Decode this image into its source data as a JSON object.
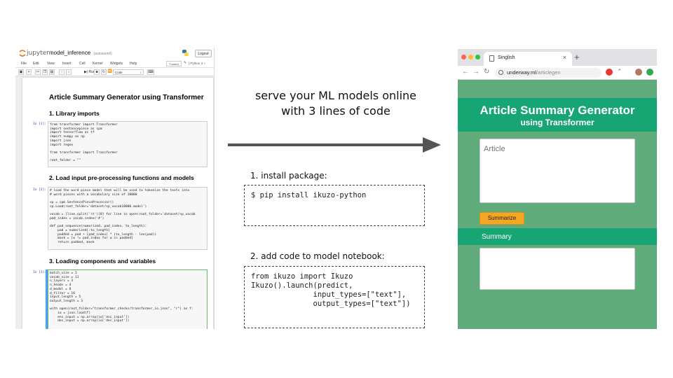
{
  "jupyter": {
    "brand": "jupyter",
    "notebook_name": "model_inference",
    "save_status": "(autosaved)",
    "logout": "Logout",
    "menu": [
      "File",
      "Edit",
      "View",
      "Insert",
      "Cell",
      "Kernel",
      "Widgets",
      "Help"
    ],
    "trusted": "Trusted",
    "kernel": "Python 3",
    "toolbar": {
      "run": "Run",
      "cell_type": "Code"
    },
    "title": "Article Summary Generator using Transformer",
    "sections": [
      {
        "heading": "1. Library imports",
        "prompt": "In [1]:",
        "code": "from transformer import Transformer\nimport sentencepiece as spm\nimport tensorflow as tf\nimport numpy as np\nimport json\nimport regex\n\nfrom transformer import Transformer\n\nroot_folder = \"\""
      },
      {
        "heading": "2. Load input pre-processing functions and models",
        "prompt": "In [2]:",
        "code": "# load the word piece model that will be used to tokenize the texts into\n# word pieces with a vocabulary size of 10000\n\nsp = spm.SentencePieceProcessor()\nsp.Load(root_folder='dataset/sp_vocab10000.model')\n\nvocab = [line.split('\\t')[0] for line in open(root_folder='dataset/sp_vocab\npad_index = vocab.index('#')\n\ndef pad_sequence(numerized, pad_index, to_length):\n    pad = numerized[:to_length]\n    padded = pad + [pad_index] * (to_length - len(pad))\n    mask = [w != pad_index for w in padded]\n    return padded, mask"
      },
      {
        "heading": "3. Loading components and variables",
        "prompt": "In [3]:",
        "code": "batch_size = 1\nvocab_size = 11\nn_layers = 3\nn_heads = 4\nd_model = 8\nd_filter = 16\ninput_length = 5\noutput_length = 3\n\nwith open(root_folder=\"transformer_checks/transformer_io.json\", \"r\") as f:\n    io = json.load(f)\n    enc_input = np.array(io['enc_input'])\n    dec_input = np.array(io['dec_input'])"
      }
    ]
  },
  "middle": {
    "tagline_line1": "serve your ML models online",
    "tagline_line2": "with 3 lines of code",
    "step1_label": "1. install package:",
    "step1_code": "$ pip install ikuzo-python",
    "step2_label": "2. add code to model notebook:",
    "step2_code": "from ikuzo import Ikuzo\nIkuzo().launch(predict,\n              input_types=[\"text\"],\n              output_types=[\"text\"])"
  },
  "browser": {
    "tab_title": "Singlish",
    "url_domain": "underway.ml",
    "url_path": "/articlegen",
    "app_title": "Article Summary Generator",
    "app_subtitle": "using Transformer",
    "article_placeholder": "Article",
    "summarize_button": "Summarize",
    "summary_label": "Summary"
  },
  "colors": {
    "banner_green": "#17a673",
    "page_green": "#60ab7c",
    "button_orange": "#f5a623"
  }
}
